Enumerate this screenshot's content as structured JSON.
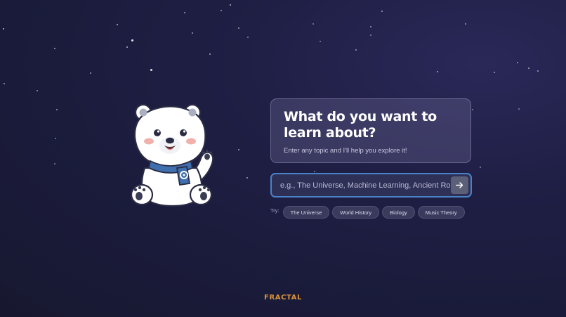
{
  "hero": {
    "heading": "What do you want to learn about?",
    "subheading": "Enter any topic and I'll help you explore it!"
  },
  "search": {
    "placeholder": "e.g., The Universe, Machine Learning, Ancient Rome...",
    "value": "",
    "submit_icon": "arrow-right-icon"
  },
  "suggestions": {
    "label": "Try:",
    "chips": [
      "The Universe",
      "World History",
      "Biology",
      "Music Theory"
    ]
  },
  "footer": {
    "brand": "FRACTAL"
  },
  "mascot": {
    "icon": "polar-bear-mascot",
    "scarf_badge_icon": "gear-icon"
  },
  "colors": {
    "background": "#1c1d3d",
    "accent_border": "#4a82c7",
    "brand": "#d9913a",
    "scarf": "#3f6fae"
  }
}
